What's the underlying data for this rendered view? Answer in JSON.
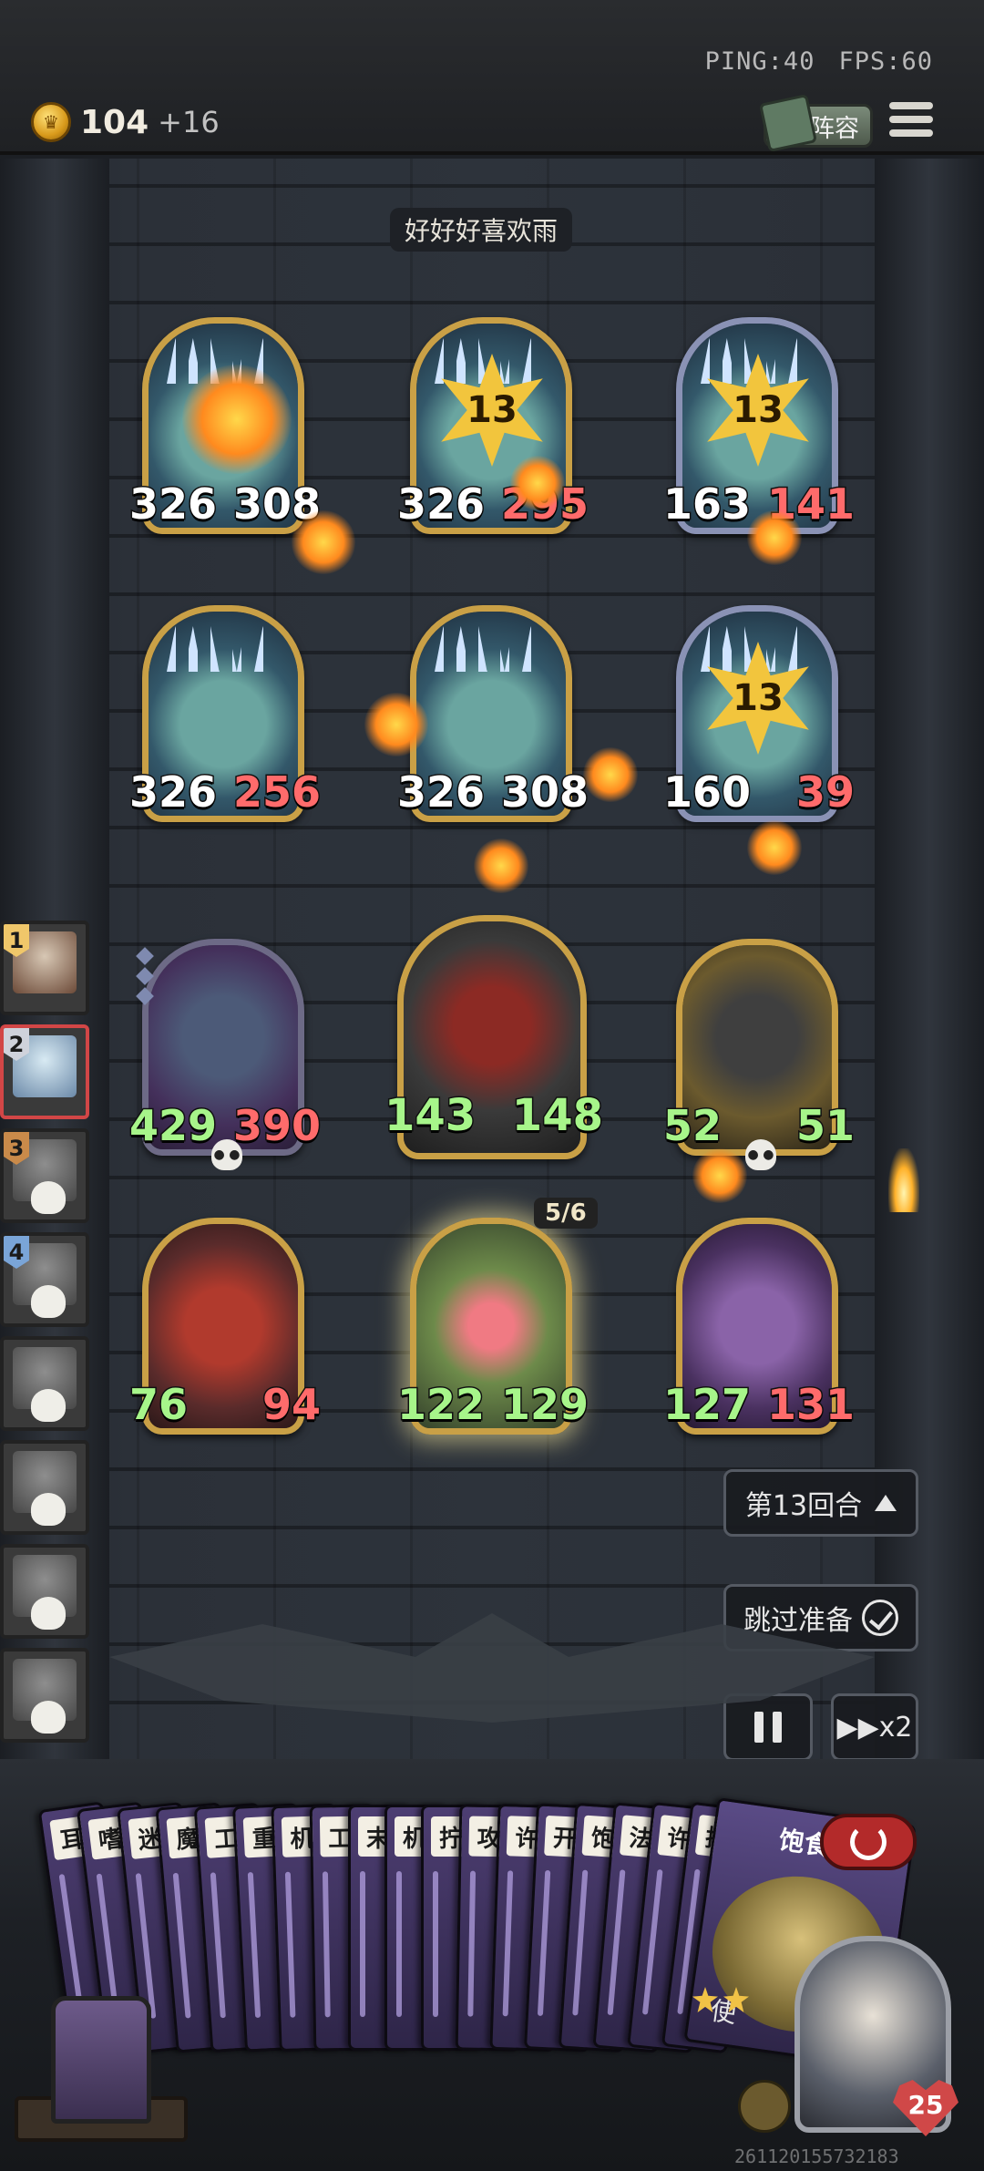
{
  "status": {
    "ping": "PING:40",
    "fps": "FPS:60"
  },
  "gold": {
    "amount": "104",
    "increment": "+16"
  },
  "lineup_label": "阵容",
  "opponent_name": "好好好喜欢雨",
  "enemy_units": [
    {
      "attack": "326",
      "health": "308",
      "frame": "gold",
      "level": ""
    },
    {
      "attack": "326",
      "health": "295",
      "frame": "gold",
      "level": "13"
    },
    {
      "attack": "163",
      "health": "141",
      "frame": "silver",
      "level": "13"
    },
    {
      "attack": "326",
      "health": "256",
      "frame": "gold",
      "level": ""
    },
    {
      "attack": "326",
      "health": "308",
      "frame": "gold",
      "level": ""
    },
    {
      "attack": "160",
      "health": "39",
      "frame": "silver",
      "level": "13"
    }
  ],
  "my_units": [
    {
      "attack": "429",
      "health": "390"
    },
    {
      "attack": "143",
      "health": "148"
    },
    {
      "attack": "52",
      "health": "51"
    },
    {
      "attack": "76",
      "health": "94"
    },
    {
      "attack": "122",
      "health": "129",
      "counter": "5/6"
    },
    {
      "attack": "127",
      "health": "131"
    }
  ],
  "players": [
    {
      "rank": "1",
      "status": "me"
    },
    {
      "rank": "2",
      "status": "active"
    },
    {
      "rank": "3",
      "status": "dead"
    },
    {
      "rank": "4",
      "status": "dead"
    },
    {
      "rank": "",
      "status": "dead"
    },
    {
      "rank": "",
      "status": "dead"
    },
    {
      "rank": "",
      "status": "dead"
    },
    {
      "rank": "",
      "status": "dead"
    }
  ],
  "controls": {
    "round": "第13回合",
    "skip_prep": "跳过准备",
    "speed": "x2"
  },
  "hand_cards": [
    "耳",
    "嗜",
    "迷",
    "魔",
    "工",
    "重",
    "机",
    "工",
    "末",
    "机",
    "拧",
    "攻",
    "许",
    "开",
    "饱",
    "法",
    "许",
    "拧"
  ],
  "featured_card": {
    "title": "饱食",
    "footer": "使"
  },
  "hero": {
    "health": "25",
    "stars": 2
  },
  "watermark": "261120155732183",
  "colors": {
    "gold_frame": "#c9a046",
    "silver_frame": "#8a92b5",
    "damaged_hp": "#ff6b6b",
    "buffed_stat": "#a7f58a",
    "card_purple": "#4d3e72"
  },
  "icons": [
    "coin-icon",
    "lineup-book-icon",
    "menu-icon",
    "skull-icon",
    "triangle-up-icon",
    "check-icon",
    "pause-icon",
    "fast-forward-icon",
    "power-icon",
    "heart-icon",
    "star-icon"
  ]
}
